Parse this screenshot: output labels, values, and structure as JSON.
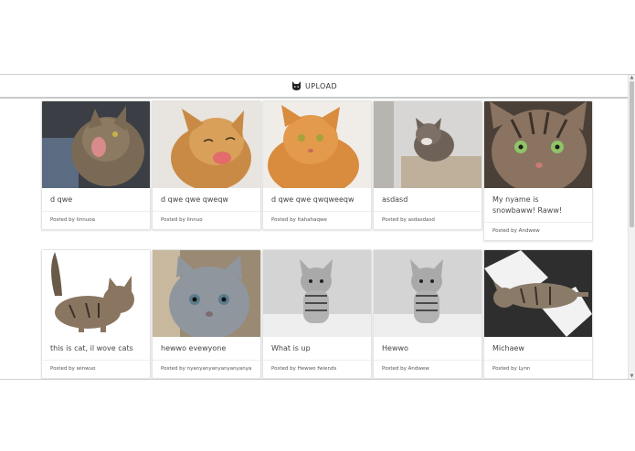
{
  "nav": {
    "upload_label": "UPLOAD",
    "icon": "cat-icon"
  },
  "cards": [
    {
      "title": "d qwe",
      "posted": "Posted by Iinnuoa"
    },
    {
      "title": "d qwe qwe qweqw",
      "posted": "Posted by Iinnuo"
    },
    {
      "title": "d qwe qwe qwqweeqw",
      "posted": "Posted by Itahahaqwe"
    },
    {
      "title": "asdasd",
      "posted": "Posted by asdasdasd"
    },
    {
      "title": "My nyame is snowbaww! Raww!",
      "posted": "Posted by Andwew"
    },
    {
      "title": "this is cat, il wove cats",
      "posted": "Posted by winwuo"
    },
    {
      "title": "hewwo evewyone",
      "posted": "Posted by nyanyanyanyanyanyanya"
    },
    {
      "title": "What is up",
      "posted": "Posted by Hewwo fwiends"
    },
    {
      "title": "Hewwo",
      "posted": "Posted by Andwew"
    },
    {
      "title": "Michaew",
      "posted": "Posted by Lynn"
    }
  ],
  "colors": {
    "page_bg": "#ffffff",
    "card_border": "#e3e3e3",
    "nav_border": "#c9c9c9"
  }
}
